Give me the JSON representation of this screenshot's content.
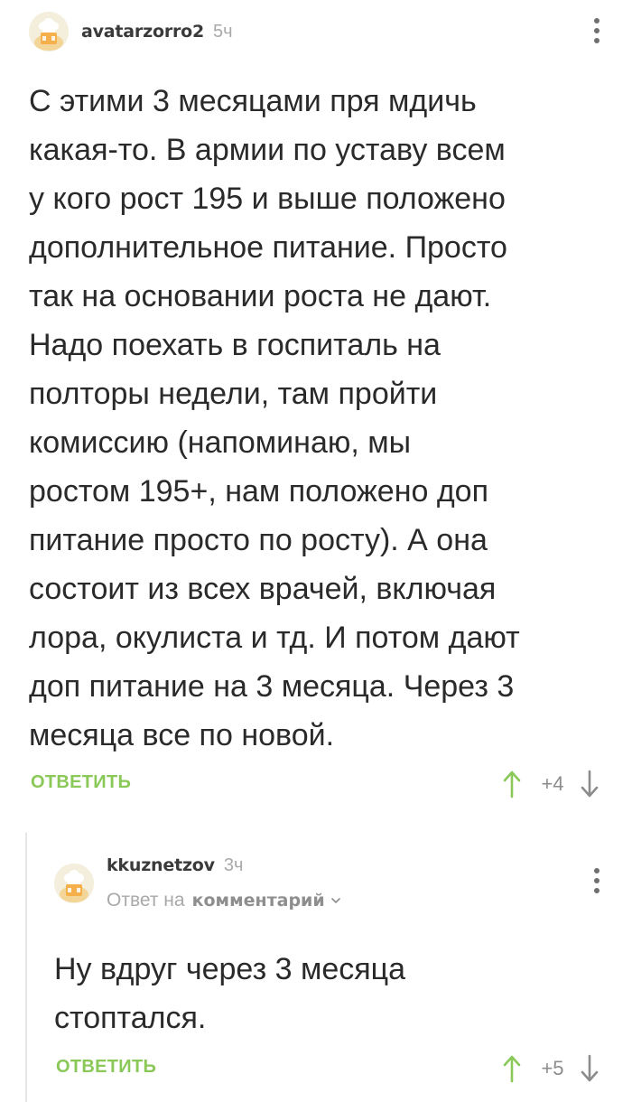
{
  "main_comment": {
    "username": "avatarzorro2",
    "time": "5ч",
    "lines": [
      "С этими 3 месяцами пря мдичь",
      "какая-то. В армии по уставу всем",
      "у кого рост 195 и выше положено",
      "дополнительное питание. Просто",
      "так на основании роста не дают.",
      "Надо поехать в госпиталь на",
      "полторы недели, там пройти",
      "комиссию (напоминаю, мы",
      "ростом 195+, нам положено доп",
      "питание просто по росту). А она",
      "состоит из всех врачей, включая",
      "лора, окулиста и тд. И потом дают",
      "доп питание на 3 месяца. Через 3",
      "месяца все по новой."
    ],
    "reply_label": "ОТВЕТИТЬ",
    "rating": "+4"
  },
  "reply_comment": {
    "username": "kkuznetzov",
    "time": "3ч",
    "reply_prefix": "Ответ на",
    "reply_target": "комментарий",
    "lines": [
      "Ну вдруг через 3 месяца",
      "стоптался."
    ],
    "reply_label": "ОТВЕТИТЬ",
    "rating": "+5"
  },
  "icons": {
    "avatar": "default-chef-avatar-icon",
    "menu": "more-vertical-icon",
    "upvote": "arrow-up-icon",
    "downvote": "arrow-down-icon",
    "dropdown": "chevron-down-icon"
  },
  "colors": {
    "accent_green": "#8ac858",
    "muted_gray": "#a9a9a9",
    "text": "#2a2a2a"
  }
}
